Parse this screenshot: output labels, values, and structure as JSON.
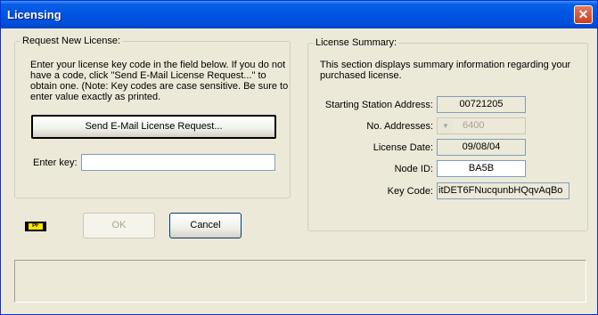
{
  "window": {
    "title": "Licensing",
    "close_label": "✕"
  },
  "request": {
    "legend": "Request New License:",
    "instructions_lines": [
      "Enter your license key code in the field below.  If you do not",
      "have a code, click \"Send E-Mail License Request...\" to",
      "obtain one.  (Note:  Key codes are case sensitive.  Be sure to",
      "enter value exactly as printed."
    ],
    "send_button": "Send E-Mail License Request...",
    "enter_key_label": "Enter key:",
    "enter_key_value": ""
  },
  "summary": {
    "legend": "License Summary:",
    "desc_lines": [
      "This section displays summary information regarding your",
      "purchased license."
    ],
    "starting_station_label": "Starting Station Address:",
    "starting_station_value": "00721205",
    "no_addresses_label": "No. Addresses:",
    "no_addresses_value": "6400",
    "license_date_label": "License Date:",
    "license_date_value": "09/08/04",
    "node_id_label": "Node ID:",
    "node_id_value": "BA5B",
    "key_code_label": "Key Code:",
    "key_code_value": "itDET6FNucqunbHQqvAqBo"
  },
  "buttons": {
    "ok": "OK",
    "cancel": "Cancel"
  },
  "chip": {
    "text": "PF"
  },
  "status_text": ""
}
